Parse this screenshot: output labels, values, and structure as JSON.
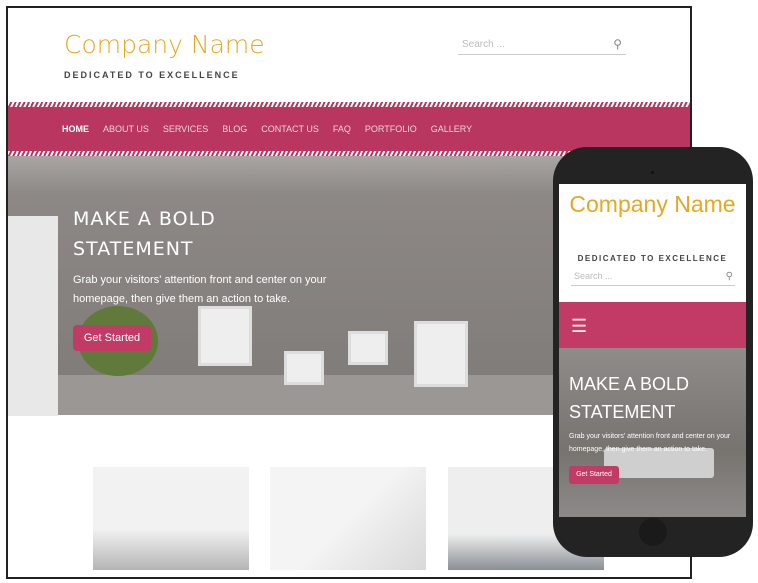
{
  "desktop": {
    "logo": "Company Name",
    "tagline": "DEDICATED TO EXCELLENCE",
    "search_placeholder": "Search ...",
    "nav": [
      "HOME",
      "ABOUT US",
      "SERVICES",
      "BLOG",
      "CONTACT US",
      "FAQ",
      "PORTFOLIO",
      "GALLERY"
    ],
    "active_nav": "HOME",
    "hero": {
      "title": "MAKE A BOLD STATEMENT",
      "subtitle": "Grab your visitors' attention front and center on your homepage, then give them an action to take.",
      "button": "Get Started"
    }
  },
  "mobile": {
    "logo": "Company Name",
    "tagline": "DEDICATED TO EXCELLENCE",
    "search_placeholder": "Search ...",
    "hero": {
      "title": "MAKE A BOLD STATEMENT",
      "subtitle": "Grab your visitors' attention front and center on your homepage, then give them an action to take.",
      "button": "Get Started"
    }
  },
  "colors": {
    "brand": "#b8365f",
    "logo": "#e5a823"
  }
}
